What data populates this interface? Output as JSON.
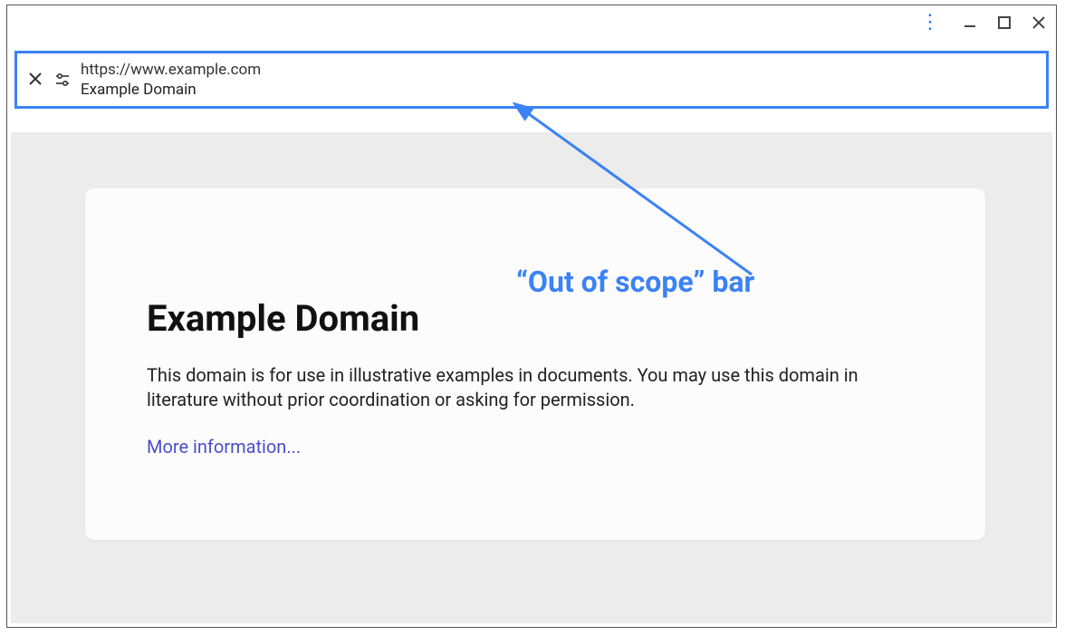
{
  "scope_bar": {
    "url": "https://www.example.com",
    "title": "Example Domain"
  },
  "card": {
    "heading": "Example Domain",
    "body": "This domain is for use in illustrative examples in documents. You may use this domain in literature without prior coordination or asking for permission.",
    "link_text": "More information..."
  },
  "annotation": {
    "label": "“Out of scope” bar"
  }
}
